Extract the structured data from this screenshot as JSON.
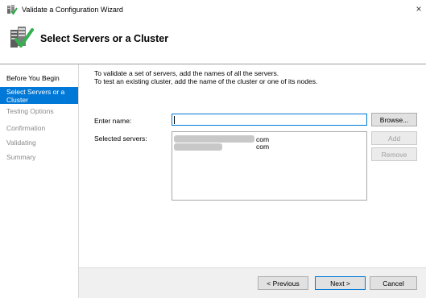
{
  "window": {
    "title": "Validate a Configuration Wizard",
    "close_glyph": "×"
  },
  "header": {
    "title": "Select Servers or a Cluster"
  },
  "sidebar": {
    "items": [
      {
        "label": "Before You Begin",
        "state": "done"
      },
      {
        "label": "Select Servers or a Cluster",
        "state": "active"
      },
      {
        "label": "Testing Options",
        "state": "pending"
      },
      {
        "label": "Confirmation",
        "state": "pending"
      },
      {
        "label": "Validating",
        "state": "pending"
      },
      {
        "label": "Summary",
        "state": "pending"
      }
    ]
  },
  "main": {
    "intro_line1": "To validate a set of servers, add the names of all the servers.",
    "intro_line2": "To test an existing cluster, add the name of the cluster or one of its nodes.",
    "enter_name_label": "Enter name:",
    "enter_name_value": "",
    "selected_servers_label": "Selected servers:",
    "selected_servers": [
      {
        "suffix": "com"
      },
      {
        "suffix": "com"
      }
    ],
    "browse_label": "Browse...",
    "add_label": "Add",
    "remove_label": "Remove"
  },
  "footer": {
    "previous_label": "< Previous",
    "next_label": "Next >",
    "cancel_label": "Cancel"
  },
  "colors": {
    "accent": "#0078d7",
    "disabled_text": "#a0a0a0",
    "pending_nav_text": "#8a8a8a"
  },
  "icons": {
    "app": "cluster-validation-icon",
    "header": "servers-check-icon",
    "close": "close-icon"
  }
}
